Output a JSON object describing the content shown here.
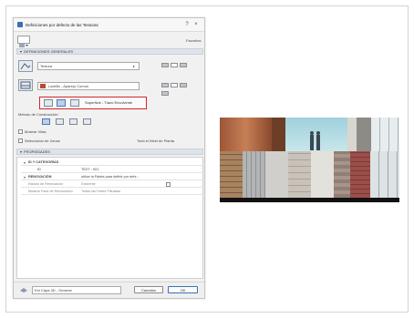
{
  "dialog": {
    "title": "Definiciones por defecto de las Texturas",
    "title_help": "?",
    "title_close": "×",
    "favorites_label": "Favoritos",
    "section_general": "DEFINICIONES GENERALES",
    "layer_field": "Textura",
    "material_field": "Ladrillo - Aparejo Común",
    "mode_label": "Superficie - Trazo Envolvente",
    "construction_method_label": "Método de Construcción:",
    "show_view_label": "Mostrar Vista",
    "select_zones_label": "Seleccionar de Zonas",
    "zones_value": "Todo el Nivel de Planta",
    "section_properties": "PROPIEDADES",
    "table": [
      {
        "marker": "▾",
        "col1": "ID Y CATEGORÍAS",
        "col2": ""
      },
      {
        "marker": "",
        "col1": "ID",
        "col2": "TEXT - 001"
      },
      {
        "marker": "▾",
        "col1": "RENOVACIÓN",
        "col2": "utilice la Paleta para definir por defe..."
      },
      {
        "marker": "",
        "col1": "Estado de Renovación",
        "col2": "Existente"
      },
      {
        "marker": "",
        "col1": "Mostrar Fase de Renovación",
        "col2": "Todas las Fases Filtradas"
      }
    ],
    "footer_layer": "Ext Capa 3D - General",
    "cancel_label": "Cancelar",
    "ok_label": "OK"
  },
  "colors": {
    "highlight_border": "#d0262a",
    "accent": "#3d6fb4"
  }
}
